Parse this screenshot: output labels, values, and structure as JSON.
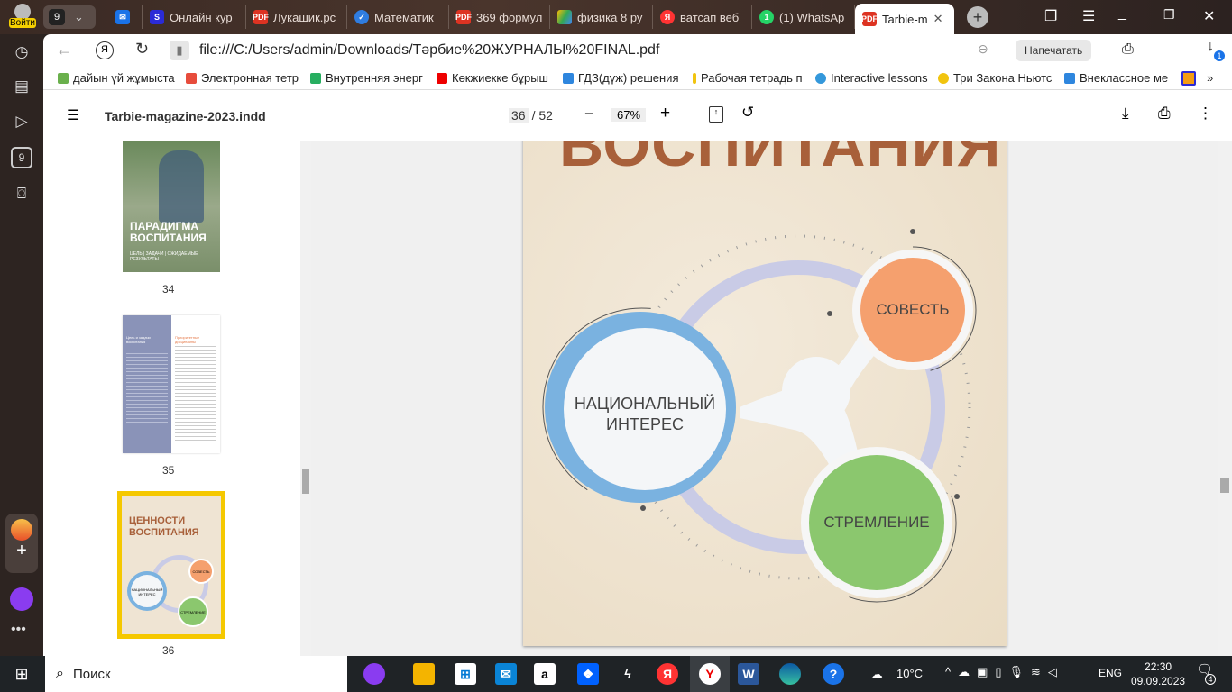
{
  "browser": {
    "login_label": "Войти",
    "tab_count": "9",
    "tabs": [
      {
        "label": "",
        "icon": "mail-icon"
      },
      {
        "label": "Онлайн кур",
        "icon": "s-icon"
      },
      {
        "label": "Лукашик.рс",
        "icon": "pdf-icon"
      },
      {
        "label": "Математик",
        "icon": "check-icon"
      },
      {
        "label": "369 формул",
        "icon": "pdf-icon"
      },
      {
        "label": "физика 8 ру",
        "icon": "drive-icon"
      },
      {
        "label": "ватсап веб",
        "icon": "yandex-icon"
      },
      {
        "label": "(1) WhatsAp",
        "icon": "whatsapp-icon"
      },
      {
        "label": "Tarbie-m",
        "icon": "pdf-icon"
      }
    ],
    "pdf_icon_text": "PDF",
    "url": "file:///C:/Users/admin/Downloads/Тәрбие%20ЖУРНАЛЫ%20FINAL.pdf",
    "print_button": "Напечатать",
    "download_badge": "1",
    "yandex_letter": "Я",
    "bookmarks": [
      "дайын үй жұмыста",
      "Электронная тетр",
      "Внутренняя энерг",
      "Көкжиекке бұрыш",
      "ГДЗ(дүж) решения",
      "Рабочая тетрадь п",
      "Interactive lessons",
      "Три Закона Ньютс",
      "Внеклассное ме"
    ],
    "bookmark_colors": [
      "#6ab04c",
      "#e74c3c",
      "#27ae60",
      "#e00",
      "#2e86de",
      "#f1c40f",
      "#3498db",
      "#f1c40f",
      "#2e86de"
    ],
    "more": "»",
    "sidebar_badge": "9"
  },
  "pdf": {
    "title": "Tarbie-magazine-2023.indd",
    "page_current": "36",
    "page_total": "/ 52",
    "zoom": "67%",
    "thumbs": [
      {
        "page": "34",
        "title": "ПАРАДИГМА ВОСПИТАНИЯ",
        "sub": "ЦЕЛЬ | ЗАДАЧИ | ОЖИДАЕМЫЕ РЕЗУЛЬТАТЫ"
      },
      {
        "page": "35",
        "title": "Цель и задачи воспитания",
        "sub": "Приоритетные дисциплины"
      },
      {
        "page": "36",
        "title": "ЦЕННОСТИ ВОСПИТАНИЯ",
        "c1": "НАЦИОНАЛЬНЫЙ ИНТЕРЕС",
        "c2": "СОВЕСТЬ",
        "c3": "СТРЕМЛЕНИЕ"
      }
    ]
  },
  "page": {
    "heading": "ВОСПИТАНИЯ",
    "circle_main": "НАЦИОНАЛЬНЫЙ ИНТЕРЕС",
    "circle_top": "СОВЕСТЬ",
    "circle_bottom": "СТРЕМЛЕНИЕ",
    "colors": {
      "blue": "#7ab2e0",
      "orange": "#f5a06e",
      "green": "#8bc76e",
      "ring": "#c9cbe6",
      "heading": "#a8603a"
    }
  },
  "taskbar": {
    "search": "Поиск",
    "temp": "10°C",
    "lang": "ENG",
    "time": "22:30",
    "date": "09.09.2023",
    "notif": "4"
  }
}
